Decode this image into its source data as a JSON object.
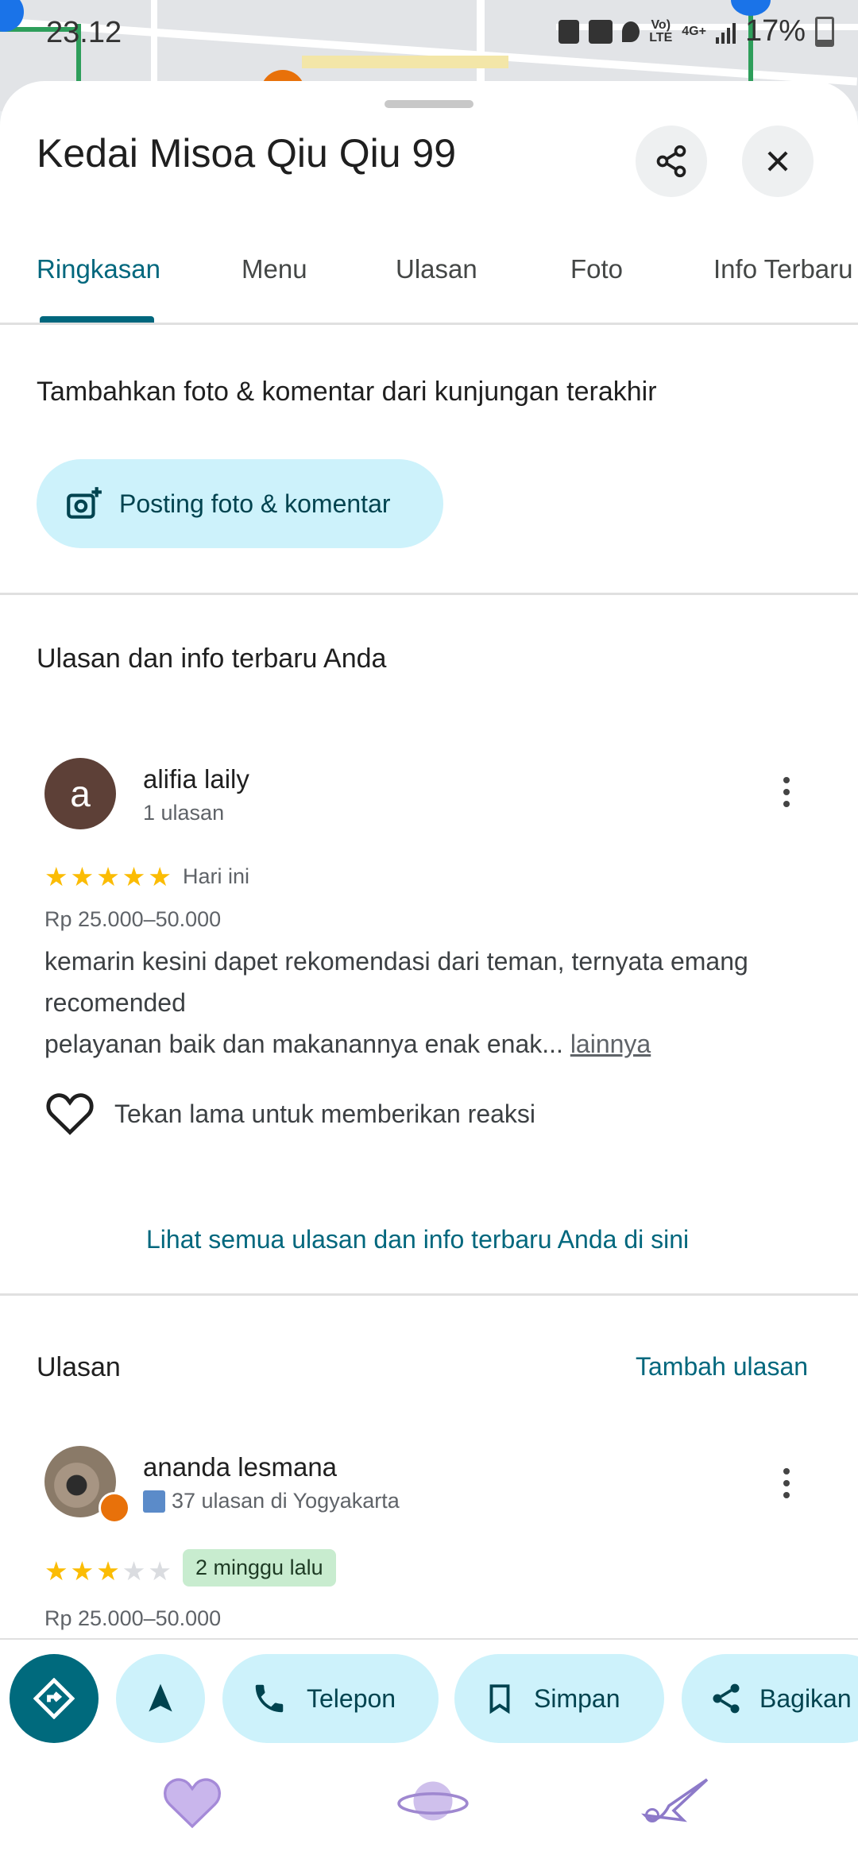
{
  "status_bar": {
    "time": "23.12",
    "network": "4G+",
    "lte_label": "Vo)\nLTE",
    "battery": "17%"
  },
  "place": {
    "title": "Kedai Misoa Qiu Qiu 99"
  },
  "tabs": [
    {
      "label": "Ringkasan",
      "active": true
    },
    {
      "label": "Menu",
      "active": false
    },
    {
      "label": "Ulasan",
      "active": false
    },
    {
      "label": "Foto",
      "active": false
    },
    {
      "label": "Info Terbaru",
      "active": false
    }
  ],
  "contribute": {
    "heading": "Tambahkan foto & komentar dari kunjungan terakhir",
    "button_label": "Posting foto & komentar"
  },
  "your_reviews": {
    "heading": "Ulasan dan info terbaru Anda",
    "review": {
      "avatar_letter": "a",
      "author": "alifia laily",
      "author_meta": "1 ulasan",
      "rating": 5,
      "date": "Hari ini",
      "price": "Rp 25.000–50.000",
      "text_line1": "kemarin kesini dapet rekomendasi dari teman, ternyata emang",
      "text_line2": "recomended",
      "text_line3": "pelayanan baik dan makanannya enak enak...",
      "more_link": "lainnya",
      "reaction_hint": "Tekan lama untuk memberikan reaksi"
    },
    "see_all_link": "Lihat semua ulasan dan info terbaru Anda di sini"
  },
  "reviews": {
    "heading": "Ulasan",
    "add_review_link": "Tambah ulasan",
    "review": {
      "author": "ananda lesmana",
      "author_meta": "37 ulasan di Yogyakarta",
      "rating": 3,
      "date": "2 minggu lalu",
      "price": "Rp 25.000–50.000"
    }
  },
  "action_bar": {
    "directions_icon": "directions-icon",
    "navigate_icon": "navigation-arrow-icon",
    "call_label": "Telepon",
    "save_label": "Simpan",
    "share_label": "Bagikan"
  },
  "colors": {
    "accent": "#00677d",
    "pill_bg": "#cdf2fb",
    "star": "#fbbc04",
    "avatar_a": "#5d4037"
  }
}
